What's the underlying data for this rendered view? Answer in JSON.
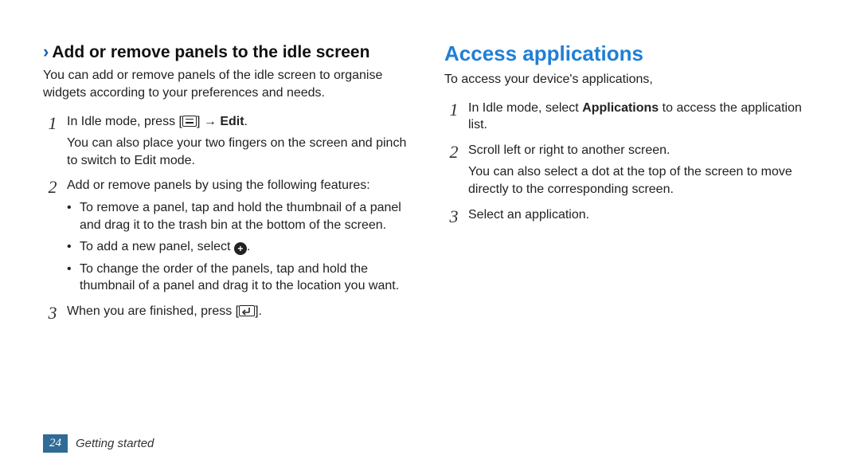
{
  "footer": {
    "page_num": "24",
    "section": "Getting started"
  },
  "left": {
    "heading": "Add or remove panels to the idle screen",
    "intro": "You can add or remove panels of the idle screen to organise widgets according to your preferences and needs.",
    "step1_a": "In Idle mode, press [",
    "step1_b": "] → ",
    "step1_edit": "Edit",
    "step1_dot": ".",
    "step1_extra": "You can also place your two fingers on the screen and pinch to switch to Edit mode.",
    "step2": "Add or remove panels by using the following features:",
    "bullet1": "To remove a panel, tap and hold the thumbnail of a panel and drag it to the trash bin at the bottom of the screen.",
    "bullet2_a": "To add a new panel, select ",
    "bullet2_b": ".",
    "bullet3": "To change the order of the panels, tap and hold the thumbnail of a panel and drag it to the location you want.",
    "step3_a": "When you are finished, press [",
    "step3_b": "]."
  },
  "right": {
    "heading": "Access applications",
    "intro": "To access your device's applications,",
    "step1_a": "In Idle mode, select ",
    "step1_bold": "Applications",
    "step1_b": " to access the application list.",
    "step2": "Scroll left or right to another screen.",
    "step2_extra": "You can also select a dot at the top of the screen to move directly to the corresponding screen.",
    "step3": "Select an application."
  }
}
